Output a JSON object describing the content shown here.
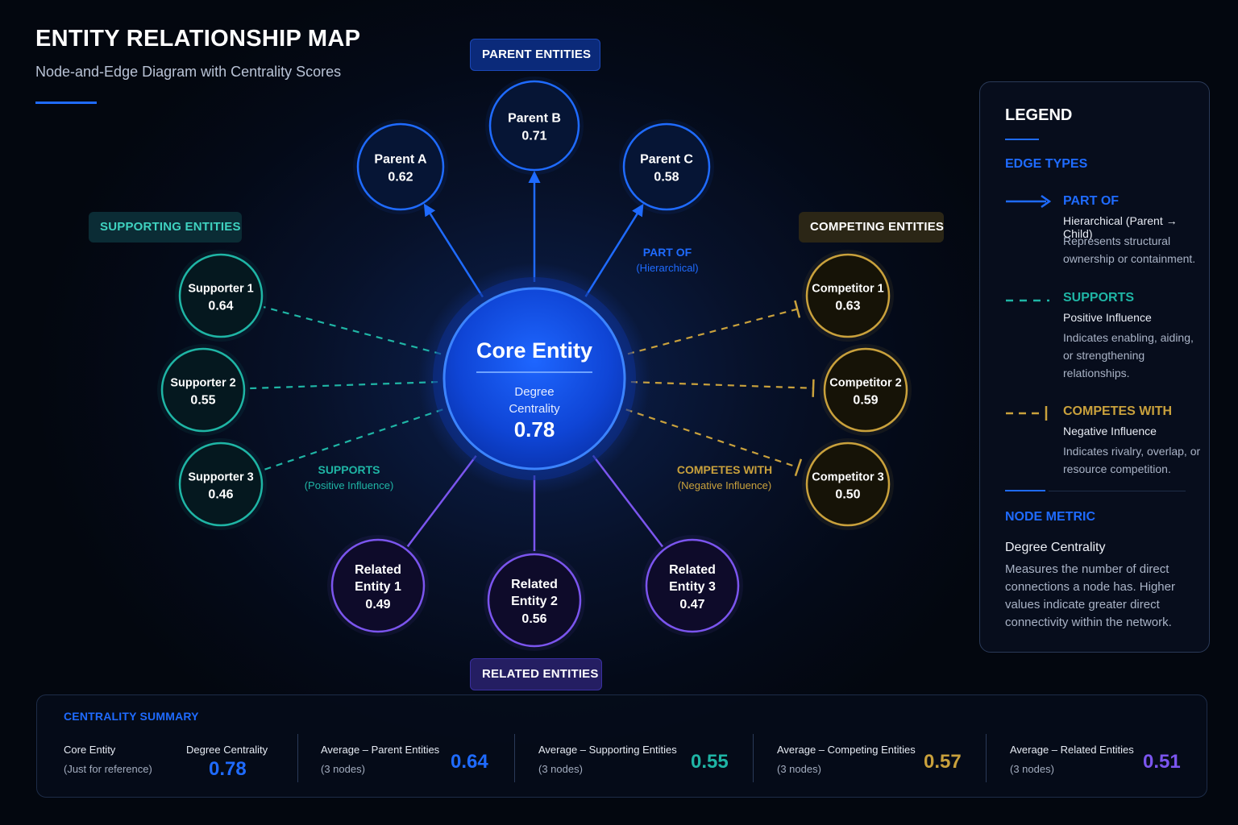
{
  "header": {
    "title": "ENTITY RELATIONSHIP MAP",
    "subtitle": "Node-and-Edge Diagram with Centrality Scores"
  },
  "groups": {
    "parent": "PARENT ENTITIES",
    "supporting": "SUPPORTING ENTITIES",
    "competing": "COMPETING ENTITIES",
    "related": "RELATED ENTITIES"
  },
  "core": {
    "name": "Core Entity",
    "metric_line1": "Degree",
    "metric_line2": "Centrality",
    "value": "0.78"
  },
  "nodes": [
    {
      "id": "parent-a",
      "group": "parent",
      "lines": [
        "Parent A"
      ],
      "value": "0.62"
    },
    {
      "id": "parent-b",
      "group": "parent",
      "lines": [
        "Parent B"
      ],
      "value": "0.71"
    },
    {
      "id": "parent-c",
      "group": "parent",
      "lines": [
        "Parent C"
      ],
      "value": "0.58"
    },
    {
      "id": "supporter-1",
      "group": "support",
      "lines": [
        "Supporter 1"
      ],
      "value": "0.64"
    },
    {
      "id": "supporter-2",
      "group": "support",
      "lines": [
        "Supporter 2"
      ],
      "value": "0.55"
    },
    {
      "id": "supporter-3",
      "group": "support",
      "lines": [
        "Supporter 3"
      ],
      "value": "0.46"
    },
    {
      "id": "competitor-1",
      "group": "compete",
      "lines": [
        "Competitor 1"
      ],
      "value": "0.63"
    },
    {
      "id": "competitor-2",
      "group": "compete",
      "lines": [
        "Competitor 2"
      ],
      "value": "0.59"
    },
    {
      "id": "competitor-3",
      "group": "compete",
      "lines": [
        "Competitor 3"
      ],
      "value": "0.50"
    },
    {
      "id": "related-1",
      "group": "related",
      "lines": [
        "Related",
        "Entity 1"
      ],
      "value": "0.49"
    },
    {
      "id": "related-2",
      "group": "related",
      "lines": [
        "Related",
        "Entity 2"
      ],
      "value": "0.56"
    },
    {
      "id": "related-3",
      "group": "related",
      "lines": [
        "Related",
        "Entity 3"
      ],
      "value": "0.47"
    }
  ],
  "edge_labels": {
    "part_of": {
      "title": "PART OF",
      "sub": "(Hierarchical)"
    },
    "supports": {
      "title": "SUPPORTS",
      "sub": "(Positive Influence)"
    },
    "competes": {
      "title": "COMPETES WITH",
      "sub": "(Negative Influence)"
    }
  },
  "legend": {
    "title": "LEGEND",
    "edge_types_heading": "EDGE TYPES",
    "part_of": {
      "title": "PART OF",
      "bold": "Hierarchical (Parent → Child)",
      "desc": "Represents structural ownership or containment."
    },
    "supports": {
      "title": "SUPPORTS",
      "bold": "Positive Influence",
      "desc": "Indicates enabling, aiding, or strengthening relationships."
    },
    "competes": {
      "title": "COMPETES WITH",
      "bold": "Negative Influence",
      "desc": "Indicates rivalry, overlap, or resource competition."
    },
    "node_metric_heading": "NODE METRIC",
    "node_metric_name": "Degree Centrality",
    "node_metric_desc": "Measures the number of direct connections a node has. Higher values indicate greater direct connectivity within the network."
  },
  "summary": {
    "title": "CENTRALITY SUMMARY",
    "core": {
      "label": "Core Entity",
      "sub": "(Just for reference)",
      "metric": "Degree Centrality",
      "value": "0.78"
    },
    "parent": {
      "label": "Average – Parent Entities",
      "sub": "(3 nodes)",
      "value": "0.64"
    },
    "supporting": {
      "label": "Average – Supporting Entities",
      "sub": "(3 nodes)",
      "value": "0.55"
    },
    "competing": {
      "label": "Average – Competing Entities",
      "sub": "(3 nodes)",
      "value": "0.57"
    },
    "related": {
      "label": "Average – Related Entities",
      "sub": "(3 nodes)",
      "value": "0.51"
    }
  },
  "colors": {
    "parent": "#1f6bff",
    "support": "#1fb5a5",
    "compete": "#c9a13c",
    "related": "#7b55ee",
    "core": "#1552e6"
  }
}
